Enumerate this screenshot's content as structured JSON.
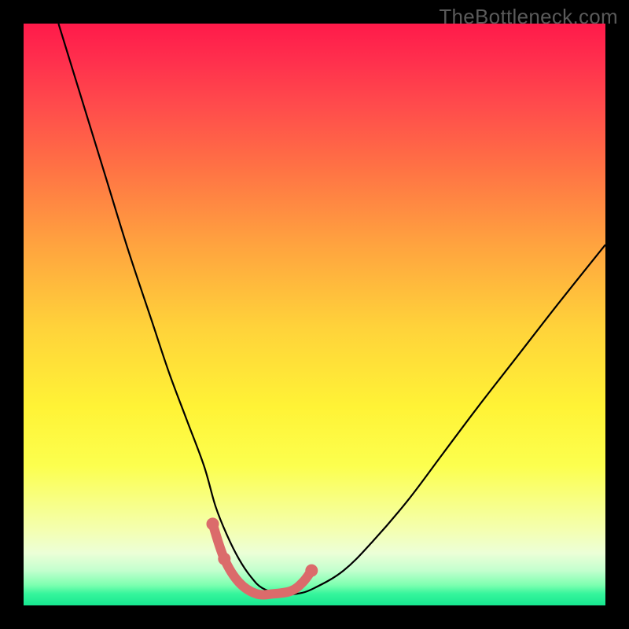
{
  "watermark": {
    "text": "TheBottleneck.com"
  },
  "chart_data": {
    "type": "line",
    "title": "",
    "xlabel": "",
    "ylabel": "",
    "xlim": [
      0,
      100
    ],
    "ylim": [
      0,
      100
    ],
    "gradient_stops": [
      {
        "pos": 0,
        "color": "#ff1a4a"
      },
      {
        "pos": 6,
        "color": "#ff2e4d"
      },
      {
        "pos": 14,
        "color": "#ff4b4c"
      },
      {
        "pos": 24,
        "color": "#ff6f45"
      },
      {
        "pos": 38,
        "color": "#ffa33f"
      },
      {
        "pos": 52,
        "color": "#ffd23a"
      },
      {
        "pos": 66,
        "color": "#fff336"
      },
      {
        "pos": 76,
        "color": "#fcff4e"
      },
      {
        "pos": 87,
        "color": "#f4ffb0"
      },
      {
        "pos": 91,
        "color": "#ecffd7"
      },
      {
        "pos": 94,
        "color": "#c3ffce"
      },
      {
        "pos": 96.5,
        "color": "#7dffb0"
      },
      {
        "pos": 98,
        "color": "#36f59c"
      },
      {
        "pos": 100,
        "color": "#17e890"
      }
    ],
    "series": [
      {
        "name": "bottleneck-curve",
        "color": "#000000",
        "stroke_width": 2.2,
        "x": [
          6,
          10,
          14,
          18,
          22,
          25,
          28,
          31,
          33,
          35,
          37,
          39,
          41,
          44,
          47,
          50,
          55,
          60,
          66,
          72,
          78,
          85,
          92,
          100
        ],
        "y": [
          100,
          87,
          74,
          61,
          49,
          40,
          32,
          24,
          17,
          12,
          8,
          5,
          3,
          2,
          2,
          3,
          6,
          11,
          18,
          26,
          34,
          43,
          52,
          62
        ]
      },
      {
        "name": "highlight-segment",
        "color": "#db6b6b",
        "stroke_width": 12,
        "linecap": "round",
        "x": [
          32.5,
          34.5,
          37,
          40,
          43,
          46,
          48,
          49.5
        ],
        "y": [
          14,
          8,
          4,
          2,
          2,
          2.5,
          4,
          6
        ]
      }
    ],
    "highlight_dots": {
      "color": "#db6b6b",
      "radius": 8,
      "points": [
        {
          "x": 32.5,
          "y": 14
        },
        {
          "x": 34.5,
          "y": 8
        },
        {
          "x": 49.5,
          "y": 6
        }
      ]
    }
  }
}
